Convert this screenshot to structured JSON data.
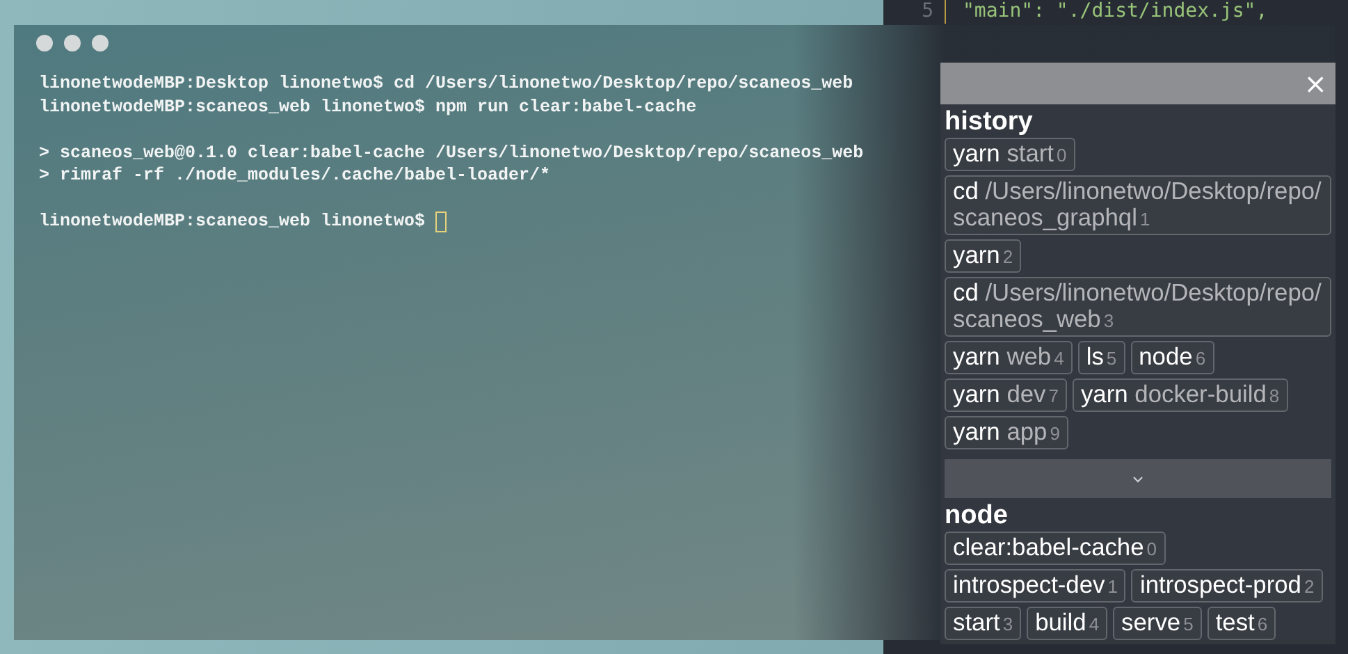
{
  "editor": {
    "line_number": "5",
    "code": "\"main\": \"./dist/index.js\","
  },
  "terminal": {
    "blocks": [
      [
        "linonetwodeMBP:Desktop linonetwo$ cd /Users/linonetwo/Desktop/repo/scaneos_web",
        "linonetwodeMBP:scaneos_web linonetwo$ npm run clear:babel-cache"
      ],
      [
        "> scaneos_web@0.1.0 clear:babel-cache /Users/linonetwo/Desktop/repo/scaneos_web",
        "> rimraf -rf ./node_modules/.cache/babel-loader/*"
      ],
      [
        "linonetwodeMBP:scaneos_web linonetwo$ "
      ]
    ]
  },
  "panel": {
    "close": "×",
    "sections": [
      {
        "title": "history",
        "expandable": true,
        "items": [
          {
            "command": "yarn",
            "args": "start",
            "index": "0"
          },
          {
            "command": "cd",
            "args": "/Users/linonetwo/Desktop/repo/ scaneos_graphql",
            "index": "1"
          },
          {
            "command": "yarn",
            "index": "2"
          },
          {
            "command": "cd",
            "args": "/Users/linonetwo/Desktop/repo/ scaneos_web",
            "index": "3"
          },
          {
            "command": "yarn",
            "args": "web",
            "index": "4"
          },
          {
            "command": "ls",
            "index": "5"
          },
          {
            "command": "node",
            "index": "6"
          },
          {
            "command": "yarn",
            "args": "dev",
            "index": "7"
          },
          {
            "command": "yarn",
            "args": "docker-build",
            "index": "8"
          },
          {
            "command": "yarn",
            "args": "app",
            "index": "9"
          }
        ]
      },
      {
        "title": "node",
        "expandable": false,
        "items": [
          {
            "command": "clear:babel-cache",
            "index": "0"
          },
          {
            "command": "introspect-dev",
            "index": "1"
          },
          {
            "command": "introspect-prod",
            "index": "2"
          },
          {
            "command": "start",
            "index": "3"
          },
          {
            "command": "build",
            "index": "4"
          },
          {
            "command": "serve",
            "index": "5"
          },
          {
            "command": "test",
            "index": "6"
          }
        ]
      }
    ]
  }
}
